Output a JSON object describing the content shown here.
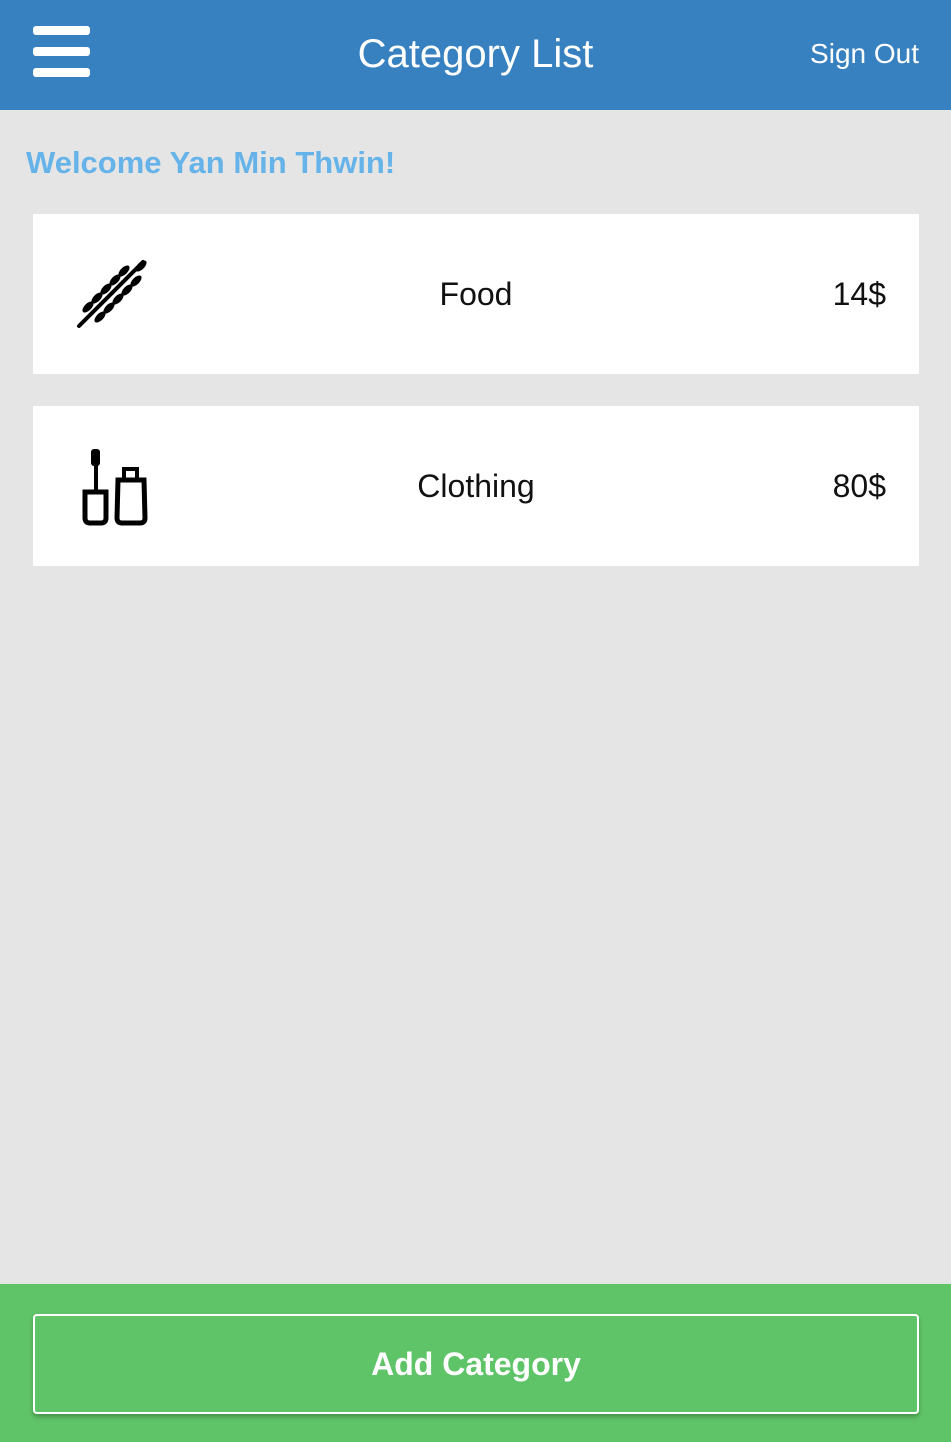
{
  "header": {
    "title": "Category List",
    "sign_out_label": "Sign Out",
    "menu_icon": "hamburger-menu-icon",
    "background_color": "#3781c1"
  },
  "welcome_text": "Welcome Yan Min Thwin!",
  "categories": [
    {
      "name": "Food",
      "amount": "14$",
      "icon": "wheat-icon"
    },
    {
      "name": "Clothing",
      "amount": "80$",
      "icon": "cosmetics-icon"
    }
  ],
  "footer": {
    "add_label": "Add Category",
    "background_color": "#5fc367"
  },
  "colors": {
    "accent_text": "#66b3ea",
    "page_background": "#e5e5e5"
  }
}
